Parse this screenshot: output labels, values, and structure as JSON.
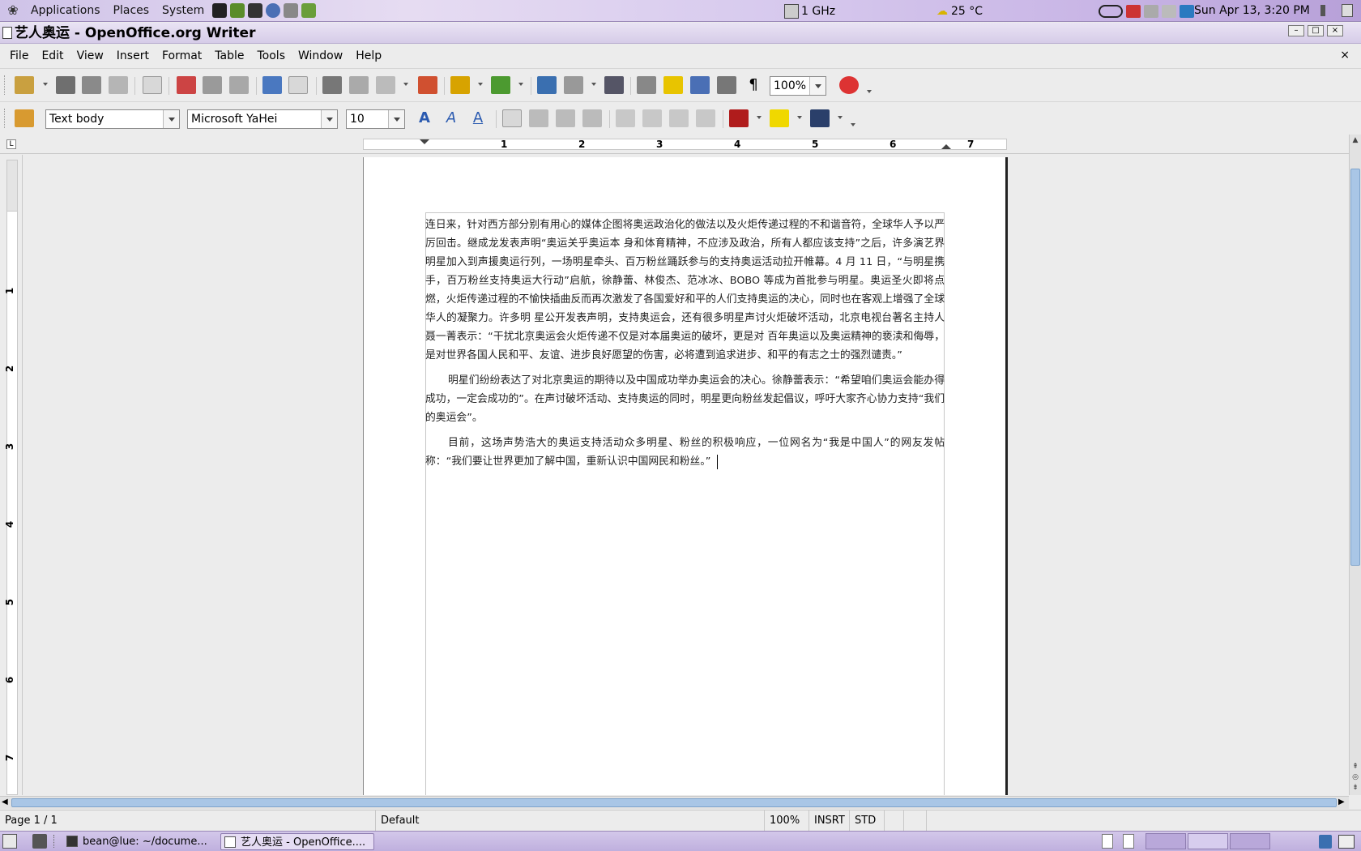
{
  "top_panel": {
    "menus": [
      "Applications",
      "Places",
      "System"
    ],
    "cpu": "1 GHz",
    "weather": "25 °C",
    "clock": "Sun Apr 13,  3:20 PM"
  },
  "window": {
    "title": "艺人奥运 - OpenOffice.org Writer"
  },
  "menubar": {
    "items": [
      "File",
      "Edit",
      "View",
      "Insert",
      "Format",
      "Table",
      "Tools",
      "Window",
      "Help"
    ],
    "close": "×"
  },
  "standard_toolbar": {
    "zoom": "100%"
  },
  "formatting_toolbar": {
    "style": "Text body",
    "font": "Microsoft YaHei",
    "size": "10"
  },
  "ruler": {
    "h_numbers": [
      "1",
      "2",
      "3",
      "4",
      "5",
      "6",
      "7"
    ],
    "v_numbers": [
      "1",
      "2",
      "3",
      "4",
      "5",
      "6",
      "7"
    ]
  },
  "document": {
    "paragraphs": [
      "连日来，针对西方部分别有用心的媒体企图将奥运政治化的做法以及火炬传递过程的不和谐音符，全球华人予以严厉回击。继成龙发表声明“奥运关乎奥运本 身和体育精神，不应涉及政治，所有人都应该支持”之后，许多演艺界明星加入到声援奥运行列，一场明星牵头、百万粉丝踊跃参与的支持奥运活动拉开帷幕。4 月 11 日，“与明星携手，百万粉丝支持奥运大行动”启航，徐静蕾、林俊杰、范冰冰、BOBO 等成为首批参与明星。奥运圣火即将点燃，火炬传递过程的不愉快插曲反而再次激发了各国爱好和平的人们支持奥运的决心，同时也在客观上增强了全球华人的凝聚力。许多明 星公开发表声明，支持奥运会，还有很多明星声讨火炬破坏活动，北京电视台著名主持人聂一菁表示：“干扰北京奥运会火炬传递不仅是对本届奥运的破坏，更是对 百年奥运以及奥运精神的亵渎和侮辱，是对世界各国人民和平、友谊、进步良好愿望的伤害，必将遭到追求进步、和平的有志之士的强烈谴责。”",
      "明星们纷纷表达了对北京奥运的期待以及中国成功举办奥运会的决心。徐静蕾表示：“希望咱们奥运会能办得成功，一定会成功的”。在声讨破坏活动、支持奥运的同时，明星更向粉丝发起倡议，呼吁大家齐心协力支持“我们的奥运会”。",
      "目前，这场声势浩大的奥运支持活动众多明星、粉丝的积极响应，一位网名为“我是中国人”的网友发帖称：“我们要让世界更加了解中国，重新认识中国网民和粉丝。”"
    ]
  },
  "statusbar": {
    "page": "Page 1 / 1",
    "page_style": "Default",
    "zoom": "100%",
    "insert_mode": "INSRT",
    "selection_mode": "STD"
  },
  "taskbar": {
    "tasks": [
      "bean@lue: ~/docume...",
      "艺人奥运 - OpenOffice...."
    ]
  },
  "colors": {
    "panel": "#cfc3e8",
    "scroll_thumb": "#a9c6e6"
  }
}
